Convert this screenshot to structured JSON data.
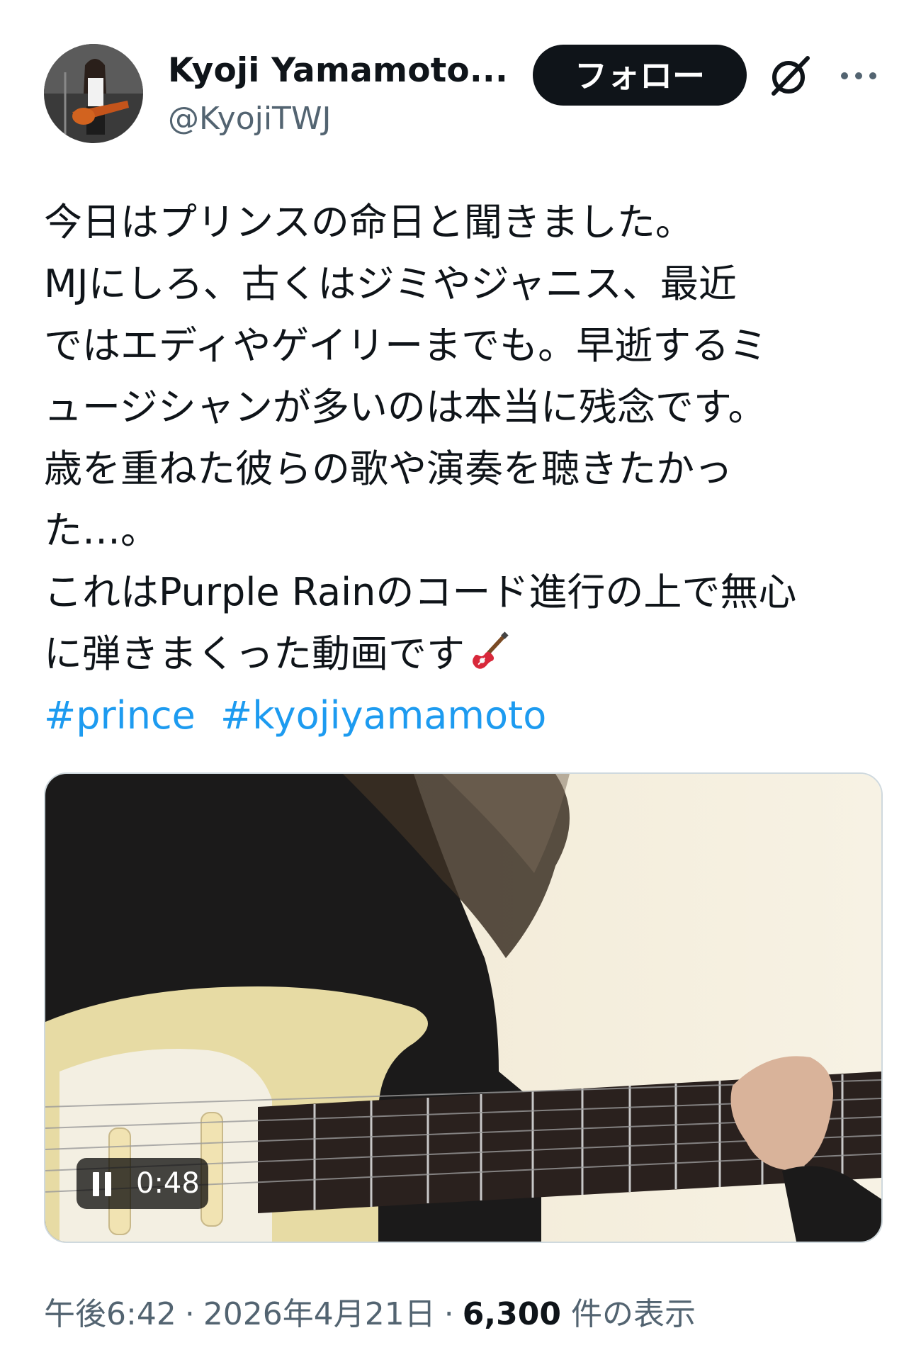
{
  "author": {
    "display_name": "Kyoji Yamamoto...",
    "handle": "@KyojiTWJ",
    "follow_label": "フォロー"
  },
  "icons": {
    "avatar": "avatar",
    "grok": "grok-icon",
    "more": "more-icon",
    "pause": "pause-icon",
    "guitar_emoji": "guitar-emoji"
  },
  "tweet": {
    "lines": [
      "今日はプリンスの命日と聞きました。",
      "MJにしろ、古くはジミやジャニス、最近",
      "ではエディやゲイリーまでも。早逝するミ",
      "ュージシャンが多いのは本当に残念です。",
      "歳を重ねた彼らの歌や演奏を聴きたかっ",
      "た…。",
      "これはPurple Rainのコード進行の上で無心",
      "に弾きまくった動画です"
    ],
    "hashtags": [
      "#prince",
      "#kyojiyamamoto"
    ]
  },
  "video": {
    "time": "0:48"
  },
  "meta": {
    "time": "午後6:42",
    "separator": "·",
    "date": "2026年4月21日",
    "views_count": "6,300",
    "views_label": "件の表示"
  },
  "colors": {
    "link": "#1d9bf0",
    "text": "#0f1419",
    "secondary": "#536471",
    "button_bg": "#0f1419"
  }
}
